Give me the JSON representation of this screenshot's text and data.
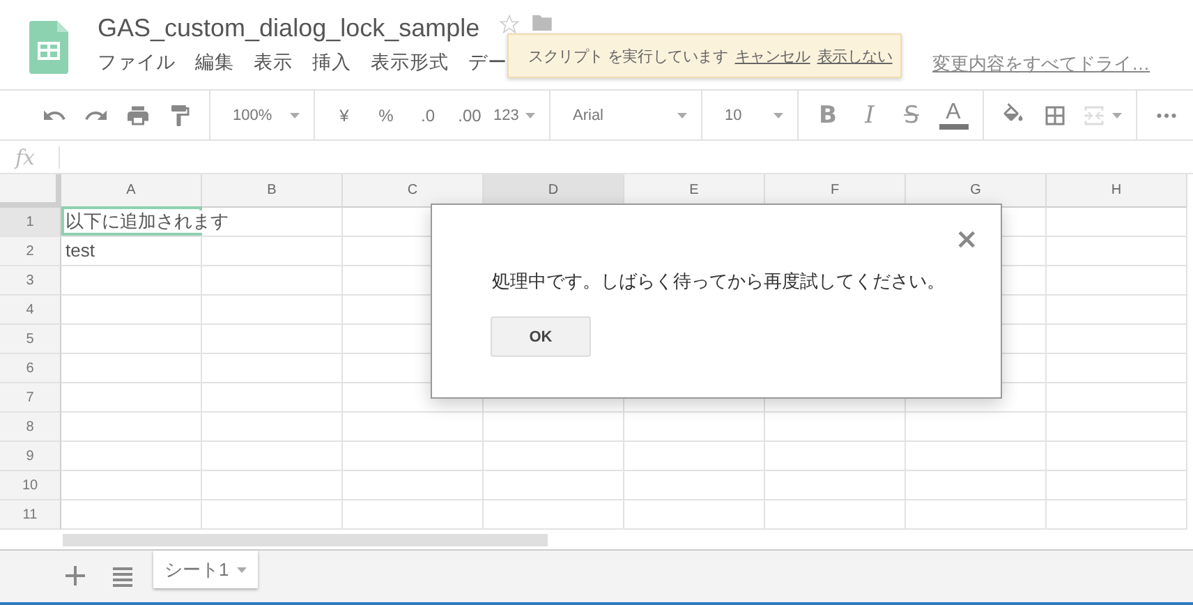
{
  "document": {
    "title": "GAS_custom_dialog_lock_sample",
    "starred": false
  },
  "menu": [
    "ファイル",
    "編集",
    "表示",
    "挿入",
    "表示形式",
    "デー"
  ],
  "banner": {
    "text": "スクリプト を実行しています",
    "actions": [
      "キャンセル",
      "表示しない"
    ]
  },
  "save_status": "変更内容をすべてドライ…",
  "toolbar": {
    "zoom": "100%",
    "currency": "¥",
    "percent": "%",
    "decrease_decimals": ".0",
    "increase_decimals": ".00",
    "number_format": "123",
    "font": "Arial",
    "font_size": "10",
    "bold": "B",
    "italic": "I",
    "strikethrough": "S",
    "text_color": "A"
  },
  "formula_bar": {
    "label": "fx"
  },
  "grid": {
    "columns": [
      {
        "label": "A",
        "highlighted": false
      },
      {
        "label": "B",
        "highlighted": false
      },
      {
        "label": "C",
        "highlighted": false
      },
      {
        "label": "D",
        "highlighted": true
      },
      {
        "label": "E",
        "highlighted": false
      },
      {
        "label": "F",
        "highlighted": false
      },
      {
        "label": "G",
        "highlighted": false
      },
      {
        "label": "H",
        "highlighted": false
      }
    ],
    "rows": [
      {
        "label": "1",
        "selected": true,
        "cells": [
          {
            "text": "以下に追加されます",
            "selected": true
          }
        ]
      },
      {
        "label": "2",
        "selected": false,
        "cells": [
          {
            "text": "test",
            "selected": false
          }
        ]
      },
      {
        "label": "3",
        "selected": false
      },
      {
        "label": "4",
        "selected": false
      },
      {
        "label": "5",
        "selected": false
      },
      {
        "label": "6",
        "selected": false
      },
      {
        "label": "7",
        "selected": false
      },
      {
        "label": "8",
        "selected": false
      },
      {
        "label": "9",
        "selected": false
      },
      {
        "label": "10",
        "selected": false
      },
      {
        "label": "11",
        "selected": false
      }
    ]
  },
  "dialog": {
    "message": "処理中です。しばらく待ってから再度試してください。",
    "button": "OK",
    "close": "×"
  },
  "sheets": [
    {
      "label": "シート1",
      "selected": true
    }
  ]
}
